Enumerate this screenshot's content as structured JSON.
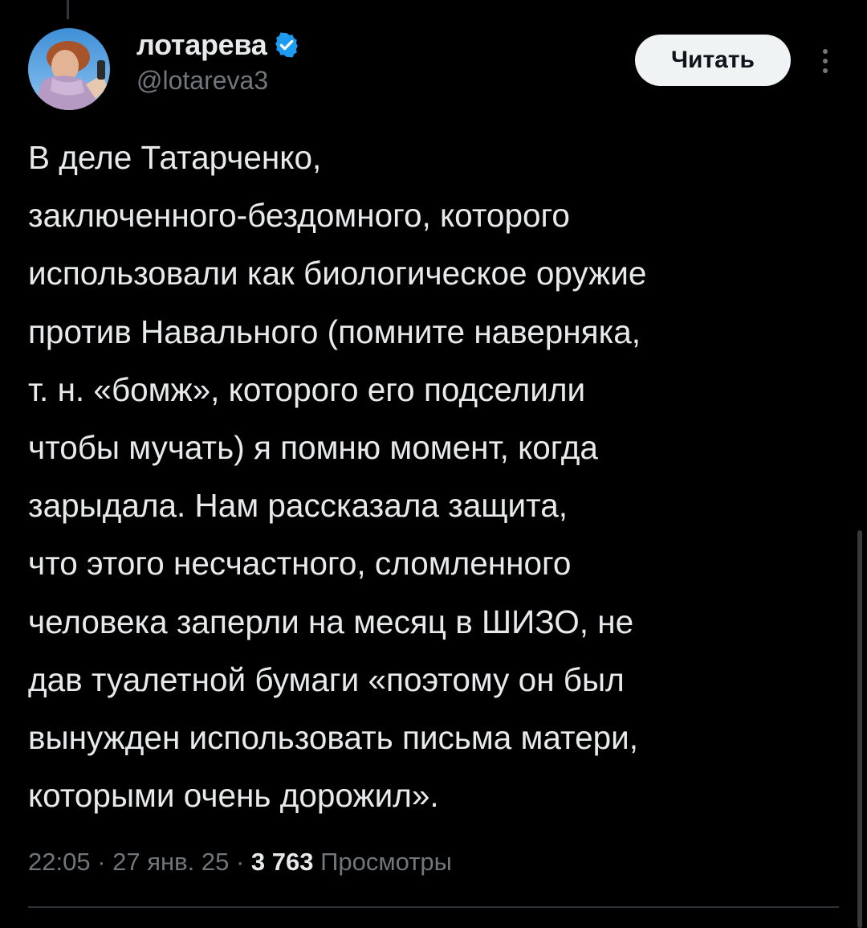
{
  "author": {
    "display_name": "лотарева",
    "handle": "@lotareva3",
    "verified": true,
    "verified_color": "#1d9bf0"
  },
  "actions": {
    "follow_label": "Читать",
    "more_icon": "more-vertical-icon"
  },
  "tweet": {
    "lines": [
      "В деле Татарченко,",
      "заключенного-бездомного, которого",
      "использовали как биологическое оружие",
      "против Навального (помните наверняка,",
      "т. н. «бомж», которого его подселили",
      "чтобы мучать) я помню момент, когда",
      "зарыдала. Нам рассказала защита,",
      "что этого несчастного, сломленного",
      "человека заперли на месяц в ШИЗО, не",
      "дав туалетной бумаги «поэтому он был",
      "вынужден использовать письма матери,",
      "которыми очень дорожил»."
    ]
  },
  "meta": {
    "time": "22:05",
    "separator": " · ",
    "date": "27 янв. 25",
    "views_count": "3 763",
    "views_label": " Просмотры"
  },
  "colors": {
    "background": "#000000",
    "text_primary": "#e7e9ea",
    "text_secondary": "#71767b",
    "button_bg": "#eff3f4",
    "button_text": "#0f1419",
    "divider": "#2f3336"
  }
}
